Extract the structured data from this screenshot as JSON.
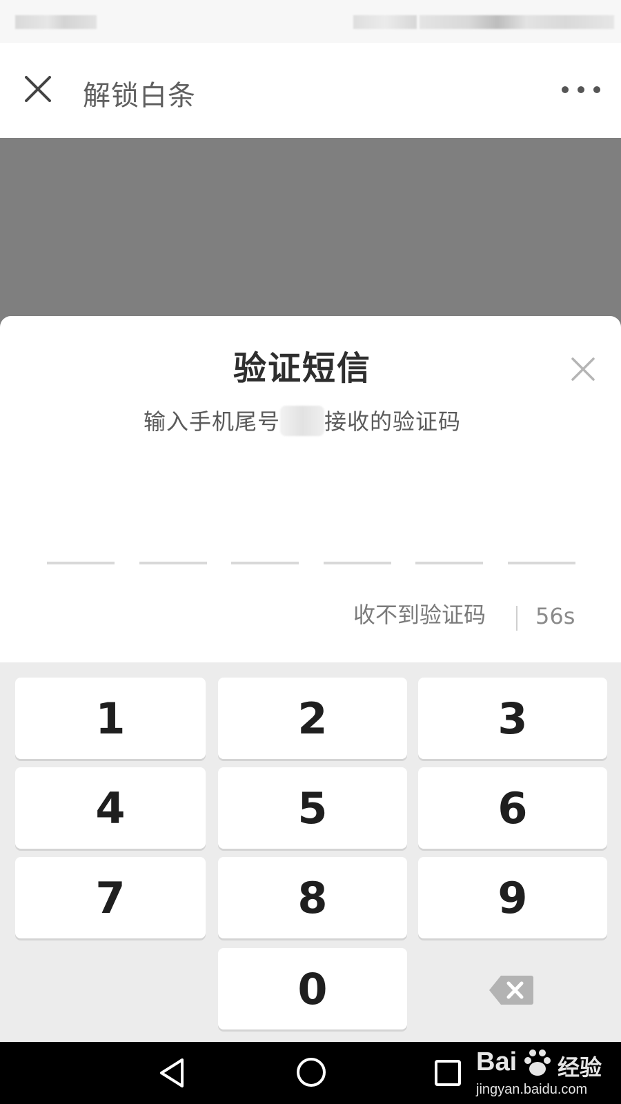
{
  "nav": {
    "title": "解锁白条"
  },
  "dialog": {
    "title": "验证短信",
    "description_prefix": "输入手机尾号",
    "description_suffix": "接收的验证码",
    "code_length": 6,
    "resend_label": "收不到验证码",
    "countdown": "56s"
  },
  "keypad": {
    "keys": [
      "1",
      "2",
      "3",
      "4",
      "5",
      "6",
      "7",
      "8",
      "9",
      "0"
    ]
  },
  "icons": {
    "close": "close-icon",
    "more": "more-icon",
    "backspace": "backspace-icon",
    "back": "back-triangle-icon",
    "home": "home-circle-icon",
    "recent": "recent-square-icon"
  },
  "watermark": {
    "brand": "Bai",
    "brand_suffix": "经验",
    "url": "jingyan.baidu.com"
  },
  "colors": {
    "overlay": "#7f7f7f",
    "keypad_bg": "#ececec",
    "key_bg": "#ffffff",
    "system_bar": "#000000"
  }
}
